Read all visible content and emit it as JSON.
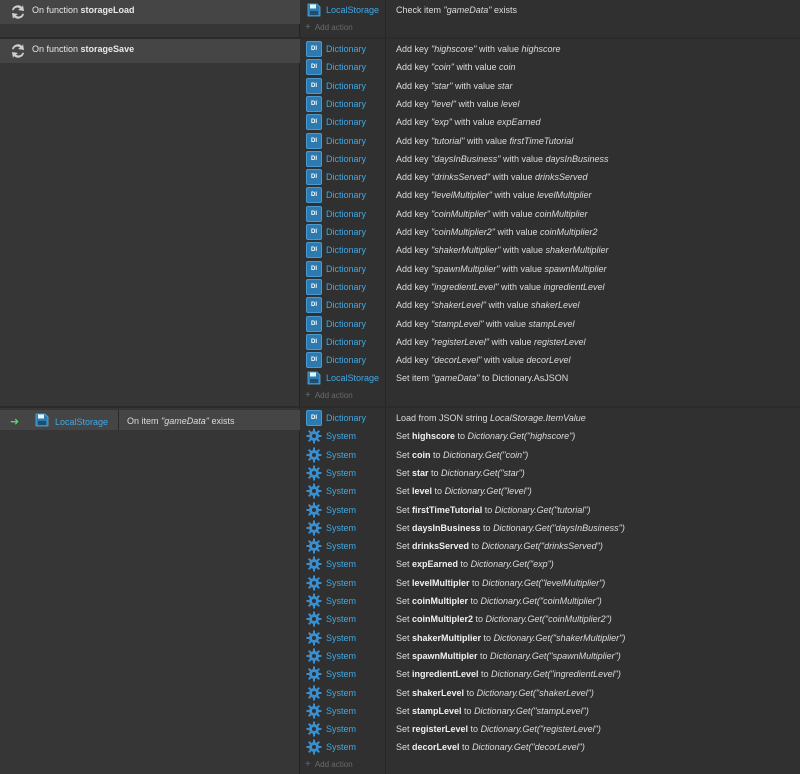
{
  "add_action_label": "Add action",
  "colors": {
    "object_link": "#3fa9e6",
    "trigger_arrow": "#4cd964",
    "dictionary_icon": "#2d7ab0"
  },
  "storage_load": {
    "prefix": "On function",
    "name": "storageLoad",
    "actions": [
      {
        "object": "LocalStorage",
        "icon": "localstorage-icon",
        "parts": [
          [
            "t",
            "Check item "
          ],
          [
            "i",
            "\"gameData\""
          ],
          [
            "t",
            " exists"
          ]
        ]
      }
    ]
  },
  "storage_save": {
    "prefix": "On function",
    "name": "storageSave",
    "actions": [
      {
        "object": "Dictionary",
        "icon": "dictionary-icon",
        "parts": [
          [
            "t",
            "Add key "
          ],
          [
            "i",
            "\"highscore\""
          ],
          [
            "t",
            " with value "
          ],
          [
            "i",
            "highscore"
          ]
        ]
      },
      {
        "object": "Dictionary",
        "icon": "dictionary-icon",
        "parts": [
          [
            "t",
            "Add key "
          ],
          [
            "i",
            "\"coin\""
          ],
          [
            "t",
            " with value "
          ],
          [
            "i",
            "coin"
          ]
        ]
      },
      {
        "object": "Dictionary",
        "icon": "dictionary-icon",
        "parts": [
          [
            "t",
            "Add key "
          ],
          [
            "i",
            "\"star\""
          ],
          [
            "t",
            " with value "
          ],
          [
            "i",
            "star"
          ]
        ]
      },
      {
        "object": "Dictionary",
        "icon": "dictionary-icon",
        "parts": [
          [
            "t",
            "Add key "
          ],
          [
            "i",
            "\"level\""
          ],
          [
            "t",
            " with value "
          ],
          [
            "i",
            "level"
          ]
        ]
      },
      {
        "object": "Dictionary",
        "icon": "dictionary-icon",
        "parts": [
          [
            "t",
            "Add key "
          ],
          [
            "i",
            "\"exp\""
          ],
          [
            "t",
            " with value "
          ],
          [
            "i",
            "expEarned"
          ]
        ]
      },
      {
        "object": "Dictionary",
        "icon": "dictionary-icon",
        "parts": [
          [
            "t",
            "Add key "
          ],
          [
            "i",
            "\"tutorial\""
          ],
          [
            "t",
            " with value "
          ],
          [
            "i",
            "firstTimeTutorial"
          ]
        ]
      },
      {
        "object": "Dictionary",
        "icon": "dictionary-icon",
        "parts": [
          [
            "t",
            "Add key "
          ],
          [
            "i",
            "\"daysInBusiness\""
          ],
          [
            "t",
            " with value "
          ],
          [
            "i",
            "daysInBusiness"
          ]
        ]
      },
      {
        "object": "Dictionary",
        "icon": "dictionary-icon",
        "parts": [
          [
            "t",
            "Add key "
          ],
          [
            "i",
            "\"drinksServed\""
          ],
          [
            "t",
            " with value "
          ],
          [
            "i",
            "drinksServed"
          ]
        ]
      },
      {
        "object": "Dictionary",
        "icon": "dictionary-icon",
        "parts": [
          [
            "t",
            "Add key "
          ],
          [
            "i",
            "\"levelMultiplier\""
          ],
          [
            "t",
            " with value "
          ],
          [
            "i",
            "levelMultiplier"
          ]
        ]
      },
      {
        "object": "Dictionary",
        "icon": "dictionary-icon",
        "parts": [
          [
            "t",
            "Add key "
          ],
          [
            "i",
            "\"coinMultiplier\""
          ],
          [
            "t",
            " with value "
          ],
          [
            "i",
            "coinMultiplier"
          ]
        ]
      },
      {
        "object": "Dictionary",
        "icon": "dictionary-icon",
        "parts": [
          [
            "t",
            "Add key "
          ],
          [
            "i",
            "\"coinMultiplier2\""
          ],
          [
            "t",
            " with value "
          ],
          [
            "i",
            "coinMultiplier2"
          ]
        ]
      },
      {
        "object": "Dictionary",
        "icon": "dictionary-icon",
        "parts": [
          [
            "t",
            "Add key "
          ],
          [
            "i",
            "\"shakerMultiplier\""
          ],
          [
            "t",
            " with value "
          ],
          [
            "i",
            "shakerMultiplier"
          ]
        ]
      },
      {
        "object": "Dictionary",
        "icon": "dictionary-icon",
        "parts": [
          [
            "t",
            "Add key "
          ],
          [
            "i",
            "\"spawnMultiplier\""
          ],
          [
            "t",
            " with value "
          ],
          [
            "i",
            "spawnMultiplier"
          ]
        ]
      },
      {
        "object": "Dictionary",
        "icon": "dictionary-icon",
        "parts": [
          [
            "t",
            "Add key "
          ],
          [
            "i",
            "\"ingredientLevel\""
          ],
          [
            "t",
            " with value "
          ],
          [
            "i",
            "ingredientLevel"
          ]
        ]
      },
      {
        "object": "Dictionary",
        "icon": "dictionary-icon",
        "parts": [
          [
            "t",
            "Add key "
          ],
          [
            "i",
            "\"shakerLevel\""
          ],
          [
            "t",
            " with value "
          ],
          [
            "i",
            "shakerLevel"
          ]
        ]
      },
      {
        "object": "Dictionary",
        "icon": "dictionary-icon",
        "parts": [
          [
            "t",
            "Add key "
          ],
          [
            "i",
            "\"stampLevel\""
          ],
          [
            "t",
            " with value "
          ],
          [
            "i",
            "stampLevel"
          ]
        ]
      },
      {
        "object": "Dictionary",
        "icon": "dictionary-icon",
        "parts": [
          [
            "t",
            "Add key "
          ],
          [
            "i",
            "\"registerLevel\""
          ],
          [
            "t",
            " with value "
          ],
          [
            "i",
            "registerLevel"
          ]
        ]
      },
      {
        "object": "Dictionary",
        "icon": "dictionary-icon",
        "parts": [
          [
            "t",
            "Add key "
          ],
          [
            "i",
            "\"decorLevel\""
          ],
          [
            "t",
            " with value "
          ],
          [
            "i",
            "decorLevel"
          ]
        ]
      },
      {
        "object": "LocalStorage",
        "icon": "localstorage-icon",
        "parts": [
          [
            "t",
            "Set item "
          ],
          [
            "i",
            "\"gameData\""
          ],
          [
            "t",
            " to Dictionary.AsJSON"
          ]
        ]
      }
    ]
  },
  "on_item_exists": {
    "object": "LocalStorage",
    "condition_parts": [
      [
        "t",
        "On item "
      ],
      [
        "i",
        "\"gameData\""
      ],
      [
        "t",
        " exists"
      ]
    ],
    "actions": [
      {
        "object": "Dictionary",
        "icon": "dictionary-icon",
        "parts": [
          [
            "t",
            "Load from JSON string "
          ],
          [
            "i",
            "LocalStorage.ItemValue"
          ]
        ]
      },
      {
        "object": "System",
        "icon": "system-gear-icon",
        "parts": [
          [
            "t",
            "Set "
          ],
          [
            "b",
            "highscore"
          ],
          [
            "t",
            " to "
          ],
          [
            "i",
            "Dictionary.Get(\"highscore\")"
          ]
        ]
      },
      {
        "object": "System",
        "icon": "system-gear-icon",
        "parts": [
          [
            "t",
            "Set "
          ],
          [
            "b",
            "coin"
          ],
          [
            "t",
            " to "
          ],
          [
            "i",
            "Dictionary.Get(\"coin\")"
          ]
        ]
      },
      {
        "object": "System",
        "icon": "system-gear-icon",
        "parts": [
          [
            "t",
            "Set "
          ],
          [
            "b",
            "star"
          ],
          [
            "t",
            " to "
          ],
          [
            "i",
            "Dictionary.Get(\"star\")"
          ]
        ]
      },
      {
        "object": "System",
        "icon": "system-gear-icon",
        "parts": [
          [
            "t",
            "Set "
          ],
          [
            "b",
            "level"
          ],
          [
            "t",
            " to "
          ],
          [
            "i",
            "Dictionary.Get(\"level\")"
          ]
        ]
      },
      {
        "object": "System",
        "icon": "system-gear-icon",
        "parts": [
          [
            "t",
            "Set "
          ],
          [
            "b",
            "firstTimeTutorial"
          ],
          [
            "t",
            " to "
          ],
          [
            "i",
            "Dictionary.Get(\"tutorial\")"
          ]
        ]
      },
      {
        "object": "System",
        "icon": "system-gear-icon",
        "parts": [
          [
            "t",
            "Set "
          ],
          [
            "b",
            "daysInBusiness"
          ],
          [
            "t",
            " to "
          ],
          [
            "i",
            "Dictionary.Get(\"daysInBusiness\")"
          ]
        ]
      },
      {
        "object": "System",
        "icon": "system-gear-icon",
        "parts": [
          [
            "t",
            "Set "
          ],
          [
            "b",
            "drinksServed"
          ],
          [
            "t",
            " to "
          ],
          [
            "i",
            "Dictionary.Get(\"drinksServed\")"
          ]
        ]
      },
      {
        "object": "System",
        "icon": "system-gear-icon",
        "parts": [
          [
            "t",
            "Set "
          ],
          [
            "b",
            "expEarned"
          ],
          [
            "t",
            " to "
          ],
          [
            "i",
            "Dictionary.Get(\"exp\")"
          ]
        ]
      },
      {
        "object": "System",
        "icon": "system-gear-icon",
        "parts": [
          [
            "t",
            "Set "
          ],
          [
            "b",
            "levelMultipler"
          ],
          [
            "t",
            " to "
          ],
          [
            "i",
            "Dictionary.Get(\"levelMultiplier\")"
          ]
        ]
      },
      {
        "object": "System",
        "icon": "system-gear-icon",
        "parts": [
          [
            "t",
            "Set "
          ],
          [
            "b",
            "coinMultipler"
          ],
          [
            "t",
            " to "
          ],
          [
            "i",
            "Dictionary.Get(\"coinMultiplier\")"
          ]
        ]
      },
      {
        "object": "System",
        "icon": "system-gear-icon",
        "parts": [
          [
            "t",
            "Set "
          ],
          [
            "b",
            "coinMultipler2"
          ],
          [
            "t",
            " to "
          ],
          [
            "i",
            "Dictionary.Get(\"coinMultiplier2\")"
          ]
        ]
      },
      {
        "object": "System",
        "icon": "system-gear-icon",
        "parts": [
          [
            "t",
            "Set "
          ],
          [
            "b",
            "shakerMultiplier"
          ],
          [
            "t",
            " to "
          ],
          [
            "i",
            "Dictionary.Get(\"shakerMultiplier\")"
          ]
        ]
      },
      {
        "object": "System",
        "icon": "system-gear-icon",
        "parts": [
          [
            "t",
            "Set "
          ],
          [
            "b",
            "spawnMultipler"
          ],
          [
            "t",
            " to "
          ],
          [
            "i",
            "Dictionary.Get(\"spawnMultiplier\")"
          ]
        ]
      },
      {
        "object": "System",
        "icon": "system-gear-icon",
        "parts": [
          [
            "t",
            "Set "
          ],
          [
            "b",
            "ingredientLevel"
          ],
          [
            "t",
            " to "
          ],
          [
            "i",
            "Dictionary.Get(\"ingredientLevel\")"
          ]
        ]
      },
      {
        "object": "System",
        "icon": "system-gear-icon",
        "parts": [
          [
            "t",
            "Set "
          ],
          [
            "b",
            "shakerLevel"
          ],
          [
            "t",
            " to "
          ],
          [
            "i",
            "Dictionary.Get(\"shakerLevel\")"
          ]
        ]
      },
      {
        "object": "System",
        "icon": "system-gear-icon",
        "parts": [
          [
            "t",
            "Set "
          ],
          [
            "b",
            "stampLevel"
          ],
          [
            "t",
            " to "
          ],
          [
            "i",
            "Dictionary.Get(\"stampLevel\")"
          ]
        ]
      },
      {
        "object": "System",
        "icon": "system-gear-icon",
        "parts": [
          [
            "t",
            "Set "
          ],
          [
            "b",
            "registerLevel"
          ],
          [
            "t",
            " to "
          ],
          [
            "i",
            "Dictionary.Get(\"registerLevel\")"
          ]
        ]
      },
      {
        "object": "System",
        "icon": "system-gear-icon",
        "parts": [
          [
            "t",
            "Set "
          ],
          [
            "b",
            "decorLevel"
          ],
          [
            "t",
            " to "
          ],
          [
            "i",
            "Dictionary.Get(\"decorLevel\")"
          ]
        ]
      }
    ]
  }
}
